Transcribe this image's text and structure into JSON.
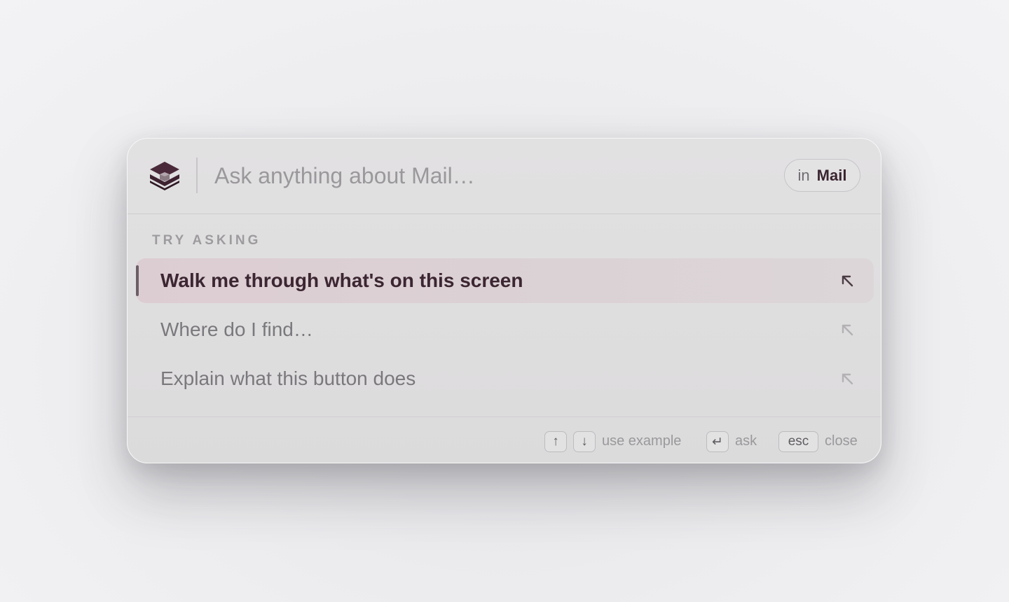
{
  "search": {
    "placeholder": "Ask anything about Mail…",
    "context_prefix": "in",
    "context_app": "Mail"
  },
  "suggestions": {
    "section_label": "TRY ASKING",
    "items": [
      {
        "label": "Walk me through what's on this screen",
        "selected": true
      },
      {
        "label": "Where do I find…",
        "selected": false
      },
      {
        "label": "Explain what this button does",
        "selected": false
      }
    ]
  },
  "footer": {
    "keys": {
      "up": "↑",
      "down": "↓",
      "enter": "↵",
      "esc": "esc"
    },
    "use_example_label": "use example",
    "ask_label": "ask",
    "close_label": "close"
  },
  "colors": {
    "accent": "#3b2631",
    "selected_bg": "#dccdd2",
    "logo": "#4a2a3a"
  },
  "icons": {
    "logo": "layered-cube-logo-icon",
    "suggestion_action": "arrow-up-left-icon"
  }
}
